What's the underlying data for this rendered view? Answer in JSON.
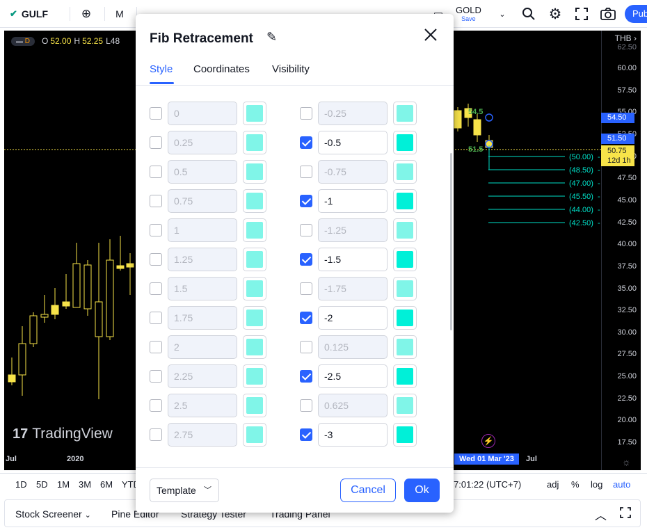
{
  "toolbar": {
    "symbol": "GULF",
    "interval": "M",
    "layout_name": "GOLD",
    "layout_save": "Save",
    "publish": "Pub"
  },
  "legend": {
    "badge": "D",
    "open": "52.00",
    "high": "52.25",
    "low_partial": "L48"
  },
  "price_scale": {
    "currency": "THB",
    "top_cut": "62.50",
    "labels": [
      "60.00",
      "57.50",
      "55.00",
      "52.50",
      "50.00",
      "47.50",
      "45.00",
      "42.50",
      "40.00",
      "37.50",
      "35.00",
      "32.50",
      "30.00",
      "27.50",
      "25.00",
      "22.50",
      "20.00",
      "17.50"
    ],
    "badge_top": "54.50",
    "badge_mid": "51.50",
    "last_price": "50.75",
    "countdown": "12d 1h"
  },
  "fib_labels": [
    "(50.00)",
    "(48.50)",
    "(47.00)",
    "(45.50)",
    "(44.00)",
    "(42.50)"
  ],
  "point_labels": {
    "upper": "54.5",
    "lower": "51.5"
  },
  "time_axis": {
    "left": "Jul",
    "year": "2020",
    "crosshair": "Wed 01 Mar '23",
    "right": "Jul"
  },
  "watermark": "TradingView",
  "range_bar": {
    "ranges": [
      "1D",
      "5D",
      "1M",
      "3M",
      "6M",
      "YTD"
    ],
    "clock": "7:01:22 (UTC+7)",
    "adj": "adj",
    "pct": "%",
    "log": "log",
    "auto": "auto"
  },
  "panel_bar": {
    "screener": "Stock Screener",
    "pine": "Pine Editor",
    "strategy": "Strategy Tester",
    "trading": "Trading Panel"
  },
  "dialog": {
    "title": "Fib Retracement",
    "tabs": {
      "style": "Style",
      "coordinates": "Coordinates",
      "visibility": "Visibility"
    },
    "levels_left": [
      {
        "value": "0",
        "checked": false
      },
      {
        "value": "0.25",
        "checked": false
      },
      {
        "value": "0.5",
        "checked": false
      },
      {
        "value": "0.75",
        "checked": false
      },
      {
        "value": "1",
        "checked": false
      },
      {
        "value": "1.25",
        "checked": false
      },
      {
        "value": "1.5",
        "checked": false
      },
      {
        "value": "1.75",
        "checked": false
      },
      {
        "value": "2",
        "checked": false
      },
      {
        "value": "2.25",
        "checked": false
      },
      {
        "value": "2.5",
        "checked": false
      },
      {
        "value": "2.75",
        "checked": false
      }
    ],
    "levels_right": [
      {
        "value": "-0.25",
        "checked": false
      },
      {
        "value": "-0.5",
        "checked": true
      },
      {
        "value": "-0.75",
        "checked": false
      },
      {
        "value": "-1",
        "checked": true
      },
      {
        "value": "-1.25",
        "checked": false
      },
      {
        "value": "-1.5",
        "checked": true
      },
      {
        "value": "-1.75",
        "checked": false
      },
      {
        "value": "-2",
        "checked": true
      },
      {
        "value": "0.125",
        "checked": false
      },
      {
        "value": "-2.5",
        "checked": true
      },
      {
        "value": "0.625",
        "checked": false
      },
      {
        "value": "-3",
        "checked": true
      }
    ],
    "template": "Template",
    "cancel": "Cancel",
    "ok": "Ok"
  },
  "colors": {
    "accent": "#2962ff",
    "level_on": "#00f0d8",
    "level_off": "#80f5e8",
    "candle": "#f7e349",
    "fib_line": "#00e0c8"
  }
}
